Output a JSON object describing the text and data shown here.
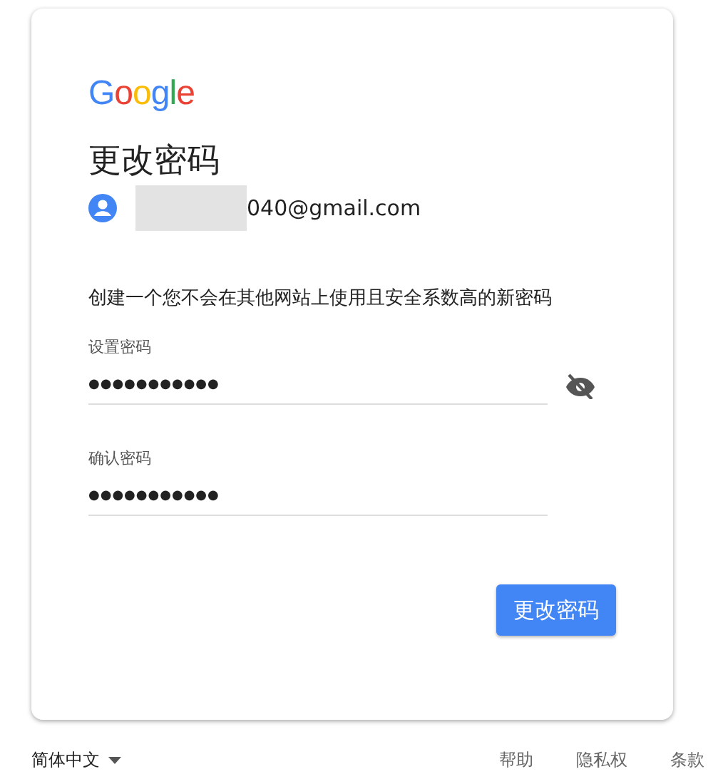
{
  "logo": {
    "text": "Google"
  },
  "title": "更改密码",
  "account": {
    "email": "040@gmail.com",
    "redacted": true
  },
  "instruction": "创建一个您不会在其他网站上使用且安全系数高的新密码",
  "fields": [
    {
      "label": "设置密码",
      "value": "●●●●●●●●●●●",
      "visibility_toggle": true,
      "password_visible": false
    },
    {
      "label": "确认密码",
      "value": "●●●●●●●●●●●",
      "visibility_toggle": false
    }
  ],
  "submit_button": "更改密码",
  "footer": {
    "language": "简体中文",
    "links": [
      "帮助",
      "隐私权",
      "条款"
    ]
  }
}
